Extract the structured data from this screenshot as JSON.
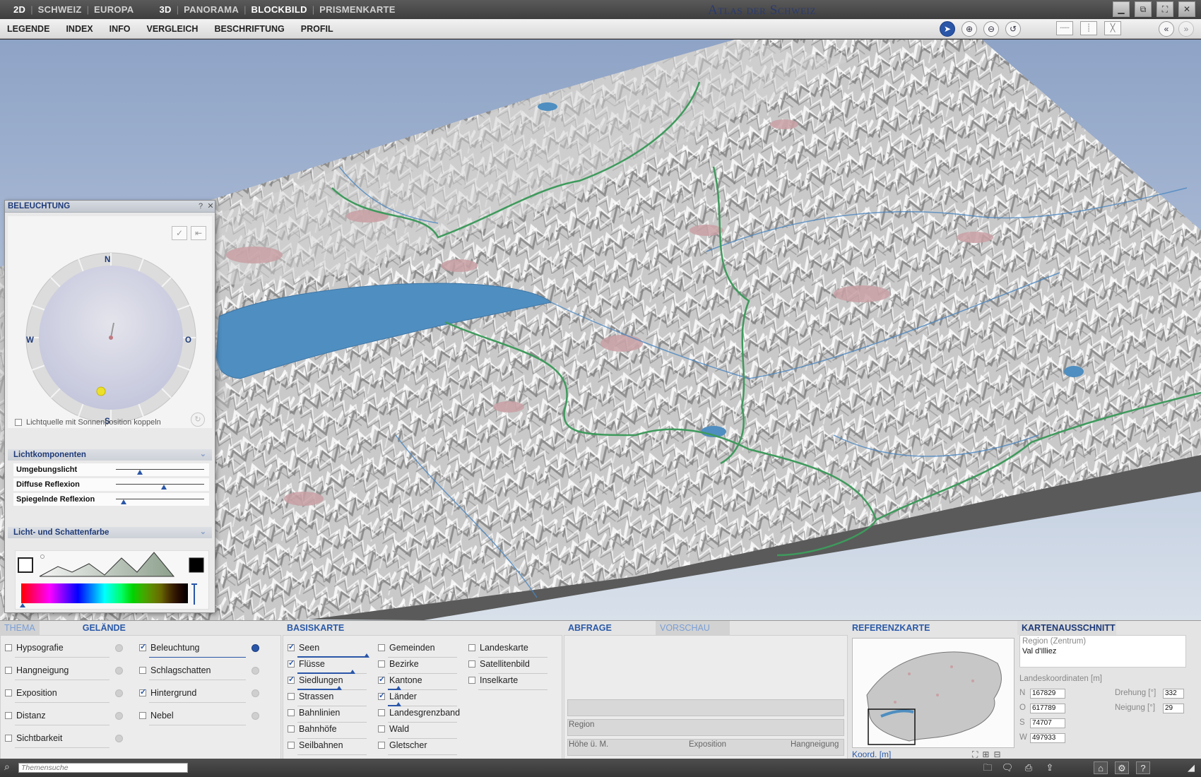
{
  "titlebar": {
    "modes": [
      {
        "label": "2D",
        "main": true
      },
      {
        "label": "SCHWEIZ"
      },
      {
        "label": "EUROPA"
      },
      {
        "label": "3D",
        "main": true,
        "gap": true
      },
      {
        "label": "PANORAMA"
      },
      {
        "label": "BLOCKBILD",
        "active": true
      },
      {
        "label": "PRISMENKARTE"
      }
    ],
    "app_title": "Atlas der Schweiz",
    "window_buttons": [
      "minimize-icon",
      "restore-icon",
      "maximize-icon",
      "close-icon"
    ]
  },
  "menubar": {
    "items": [
      "LEGENDE",
      "INDEX",
      "INFO",
      "VERGLEICH",
      "BESCHRIFTUNG",
      "PROFIL"
    ],
    "map_tools": [
      {
        "icon": "pointer-icon",
        "active": true
      },
      {
        "icon": "zoom-in-icon"
      },
      {
        "icon": "zoom-out-icon"
      },
      {
        "icon": "pan-icon"
      }
    ],
    "view_tools": [
      "horizontal-split-icon",
      "vertical-split-icon",
      "no-split-icon"
    ],
    "collapse_buttons": [
      "collapse-left-icon",
      "collapse-right-icon"
    ]
  },
  "light_panel": {
    "title": "BELEUCHTUNG",
    "compass": {
      "n": "N",
      "s": "S",
      "w": "W",
      "o": "O"
    },
    "coupling_label": "Lichtquelle mit Sonnenposition koppeln",
    "section_components": "Lichtkomponenten",
    "sliders": [
      {
        "label": "Umgebungslicht",
        "value": 0.27
      },
      {
        "label": "Diffuse Reflexion",
        "value": 0.54
      },
      {
        "label": "Spiegelnde Reflexion",
        "value": 0.09
      }
    ],
    "section_colors": "Licht- und Schattenfarbe",
    "accent_color": "#2a56a8"
  },
  "layers": {
    "tabs": {
      "thema": "THEMA",
      "gelaende": "GELÄNDE"
    },
    "left_items": [
      {
        "label": "Hypsografie",
        "checked": false
      },
      {
        "label": "Hangneigung",
        "checked": false
      },
      {
        "label": "Exposition",
        "checked": false
      },
      {
        "label": "Distanz",
        "checked": false
      },
      {
        "label": "Sichtbarkeit",
        "checked": false
      }
    ],
    "right_items": [
      {
        "label": "Beleuchtung",
        "checked": true,
        "selected": true
      },
      {
        "label": "Schlagschatten",
        "checked": false
      },
      {
        "label": "Hintergrund",
        "checked": true
      },
      {
        "label": "Nebel",
        "checked": false
      }
    ]
  },
  "basiskarte": {
    "title": "BASISKARTE",
    "col1": [
      {
        "label": "Seen",
        "checked": true,
        "bar": 1.0
      },
      {
        "label": "Flüsse",
        "checked": true,
        "bar": 0.8
      },
      {
        "label": "Siedlungen",
        "checked": true,
        "bar": 0.6
      },
      {
        "label": "Strassen",
        "checked": false
      },
      {
        "label": "Bahnlinien",
        "checked": false
      },
      {
        "label": "Bahnhöfe",
        "checked": false
      },
      {
        "label": "Seilbahnen",
        "checked": false
      }
    ],
    "col2": [
      {
        "label": "Gemeinden",
        "checked": false
      },
      {
        "label": "Bezirke",
        "checked": false
      },
      {
        "label": "Kantone",
        "checked": true,
        "bar": 0.15
      },
      {
        "label": "Länder",
        "checked": true,
        "bar": 0.15
      },
      {
        "label": "Landesgrenzband",
        "checked": false
      },
      {
        "label": "Wald",
        "checked": false
      },
      {
        "label": "Gletscher",
        "checked": false
      }
    ],
    "col3": [
      {
        "label": "Landeskarte",
        "checked": false
      },
      {
        "label": "Satellitenbild",
        "checked": false
      },
      {
        "label": "Inselkarte",
        "checked": false
      }
    ]
  },
  "abfrage": {
    "tab_query": "ABFRAGE",
    "tab_preview": "VORSCHAU",
    "region_label": "Region",
    "hoehe_label": "Höhe ü. M.",
    "exposition_label": "Exposition",
    "hangneigung_label": "Hangneigung"
  },
  "referenzkarte": {
    "title": "REFERENZKARTE",
    "coord_label": "Koord. [m]"
  },
  "kartenausschnitt": {
    "title": "KARTENAUSSCHNITT",
    "region_label": "Region (Zentrum)",
    "region_value": "Val d'Illiez",
    "coords_label": "Landeskoordinaten [m]",
    "n_label": "N",
    "n_value": "167829",
    "o_label": "O",
    "o_value": "617789",
    "s_label": "S",
    "s_value": "74707",
    "w_label": "W",
    "w_value": "497933",
    "drehung_label": "Drehung [°]",
    "drehung_value": "332",
    "neigung_label": "Neigung [°]",
    "neigung_value": "29"
  },
  "statusbar": {
    "search_placeholder": "Themensuche"
  }
}
